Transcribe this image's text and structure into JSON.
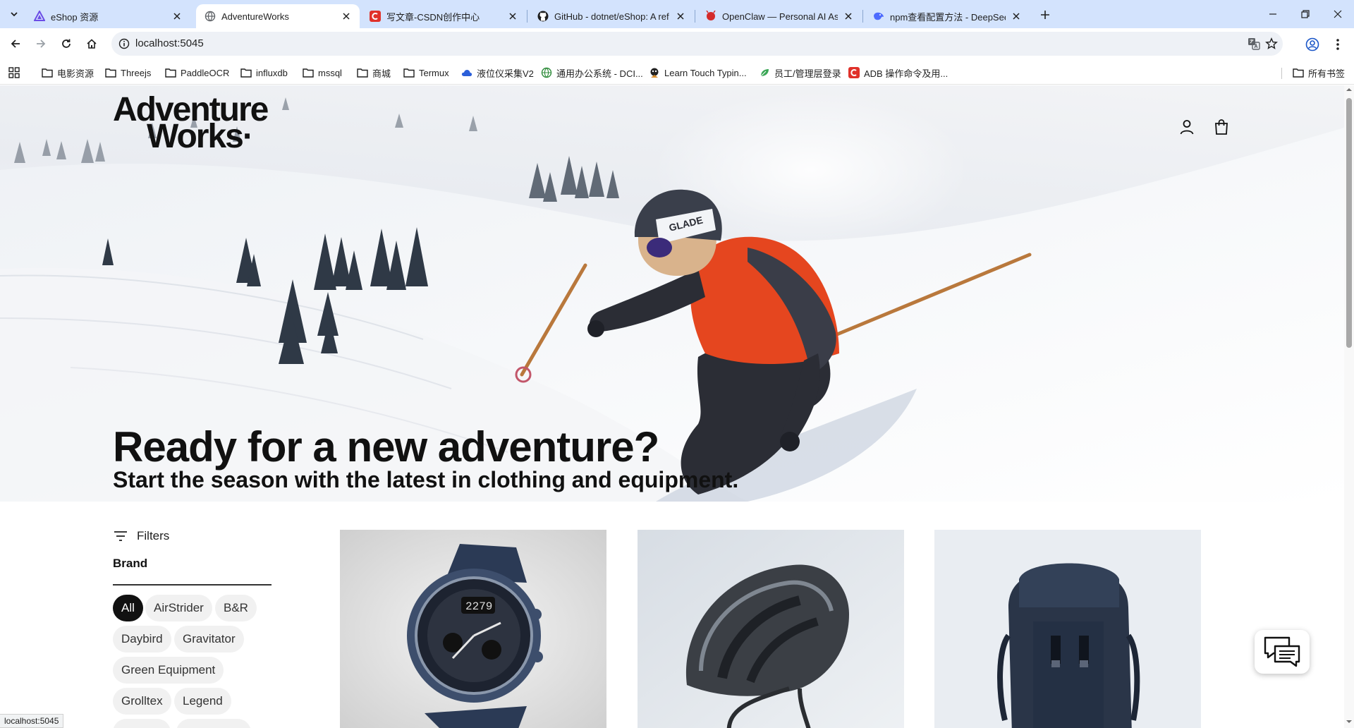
{
  "browser": {
    "tabs": [
      {
        "title": "eShop 资源",
        "favicon": "triangle-logo-icon",
        "active": false
      },
      {
        "title": "AdventureWorks",
        "favicon": "globe-icon",
        "active": true
      },
      {
        "title": "写文章-CSDN创作中心",
        "favicon": "csdn-logo-icon",
        "active": false
      },
      {
        "title": "GitHub - dotnet/eShop: A ref",
        "favicon": "github-logo-icon",
        "active": false
      },
      {
        "title": "OpenClaw — Personal AI Ass",
        "favicon": "claw-logo-icon",
        "active": false
      },
      {
        "title": "npm查看配置方法 - DeepSeek",
        "favicon": "deepseek-logo-icon",
        "active": false
      }
    ],
    "address": "localhost:5045",
    "bookmarks": [
      {
        "label": "电影资源",
        "icon": "folder-icon"
      },
      {
        "label": "Threejs",
        "icon": "folder-icon"
      },
      {
        "label": "PaddleOCR",
        "icon": "folder-icon"
      },
      {
        "label": "influxdb",
        "icon": "folder-icon"
      },
      {
        "label": "mssql",
        "icon": "folder-icon"
      },
      {
        "label": "商城",
        "icon": "folder-icon"
      },
      {
        "label": "Termux",
        "icon": "folder-icon"
      },
      {
        "label": "液位仪采集V2",
        "icon": "cloud-icon"
      },
      {
        "label": "通用办公系统 - DCI...",
        "icon": "globe-icon"
      },
      {
        "label": "Learn Touch Typin...",
        "icon": "typing-icon"
      },
      {
        "label": "员工/管理层登录",
        "icon": "leaf-icon"
      },
      {
        "label": "ADB 操作命令及用...",
        "icon": "csdn-logo-icon"
      }
    ],
    "all_bookmarks": "所有书签",
    "status_url": "localhost:5045"
  },
  "site": {
    "logo_line1": "Adventure",
    "logo_line2": "Works",
    "logo_mark": "·",
    "headline": "Ready for a new adventure?",
    "subheadline": "Start the season with the latest in clothing and equipment.",
    "filters_label": "Filters",
    "brand_label": "Brand",
    "brands": [
      "All",
      "AirStrider",
      "B&R",
      "Daybird",
      "Gravitator",
      "Green Equipment",
      "Grolltex",
      "Legend"
    ],
    "selected_brand": "All",
    "products": [
      {
        "image": "smart-watch"
      },
      {
        "image": "bike-helmet"
      },
      {
        "image": "hiking-backpack"
      }
    ]
  },
  "colors": {
    "tabstrip": "#d3e3fd",
    "accent_dark": "#111111",
    "chip_bg": "#f1f1f1",
    "jacket": "#e5461f"
  }
}
